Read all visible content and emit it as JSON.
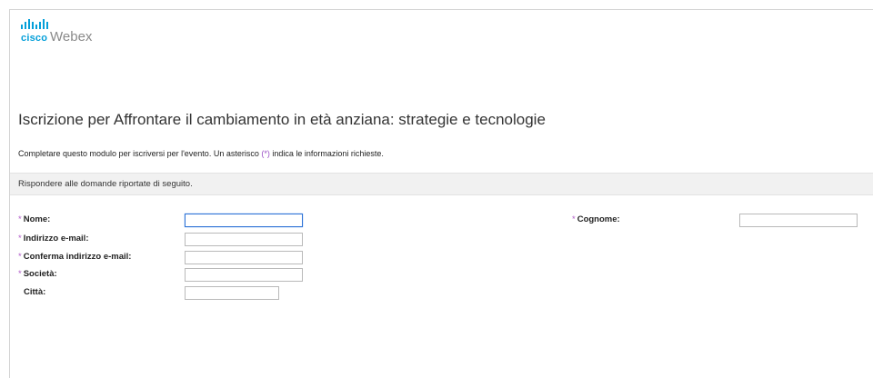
{
  "brand": {
    "company": "cisco",
    "product": "Webex",
    "accent_color": "#049fd9"
  },
  "page": {
    "title": "Iscrizione per Affrontare il cambiamento in età anziana: strategie e tecnologie",
    "intro_before": "Completare questo modulo per iscriversi per l'evento. Un asterisco ",
    "intro_asterisk": "(*)",
    "intro_after": " indica le informazioni richieste."
  },
  "section": {
    "label": "Rispondere alle domande riportate di seguito."
  },
  "form": {
    "required_mark": "*",
    "fields": [
      {
        "label": "Nome:",
        "required": true,
        "value": "",
        "focused": true
      },
      {
        "label": "Indirizzo e-mail:",
        "required": true,
        "value": ""
      },
      {
        "label": "Conferma indirizzo e-mail:",
        "required": true,
        "value": ""
      },
      {
        "label": "Società:",
        "required": true,
        "value": ""
      },
      {
        "label": "Città:",
        "required": false,
        "value": ""
      },
      {
        "label": "Cognome:",
        "required": true,
        "value": ""
      }
    ]
  }
}
